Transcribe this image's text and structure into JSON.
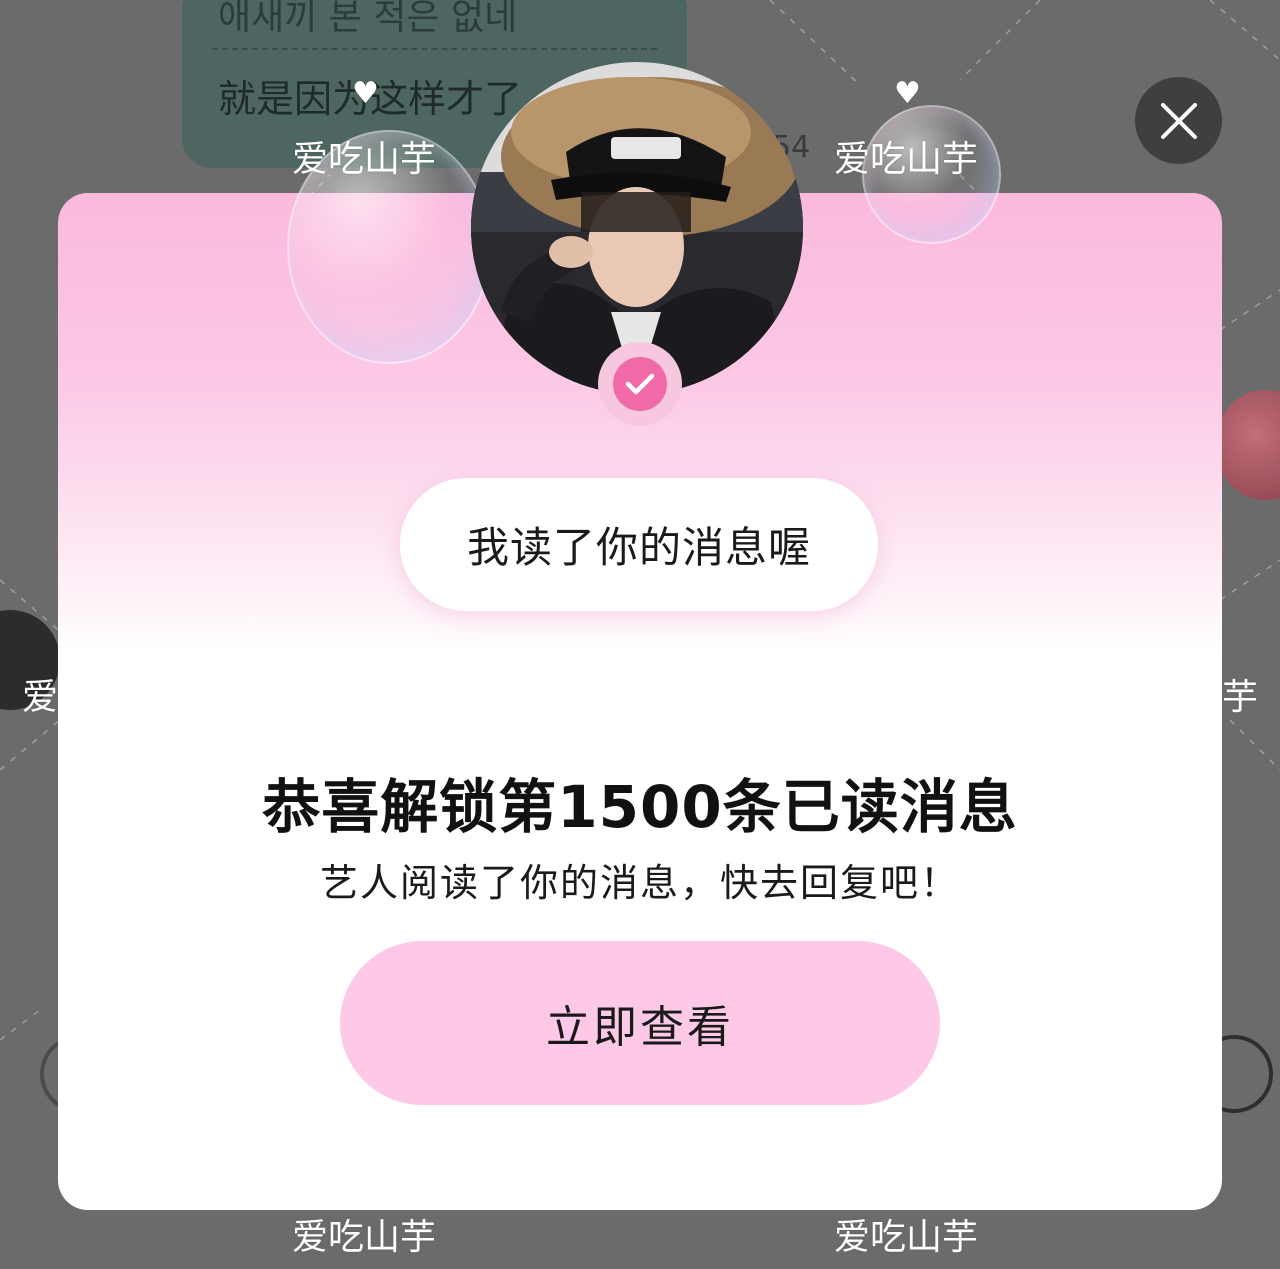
{
  "background": {
    "chat_line_top": "애새끼 본 적은 없네",
    "chat_line_bottom": "就是因为这样才了",
    "time_fragment": "54"
  },
  "watermark": {
    "text": "爱吃山芋",
    "heart_glyph": "♥",
    "edge_left": "爱",
    "edge_right": "芋"
  },
  "modal": {
    "close_icon": "close-icon",
    "badge_icon": "check-icon",
    "speech_text": "我读了你的消息喔",
    "title": "恭喜解锁第1500条已读消息",
    "subtitle": "艺人阅读了你的消息，快去回复吧！",
    "cta_label": "立即查看"
  },
  "colors": {
    "card_top_pink": "#fbb9dc",
    "cta_pink": "#fdc9e7",
    "badge_pink": "#f06aa8",
    "overlay": "#6b6b6b"
  }
}
